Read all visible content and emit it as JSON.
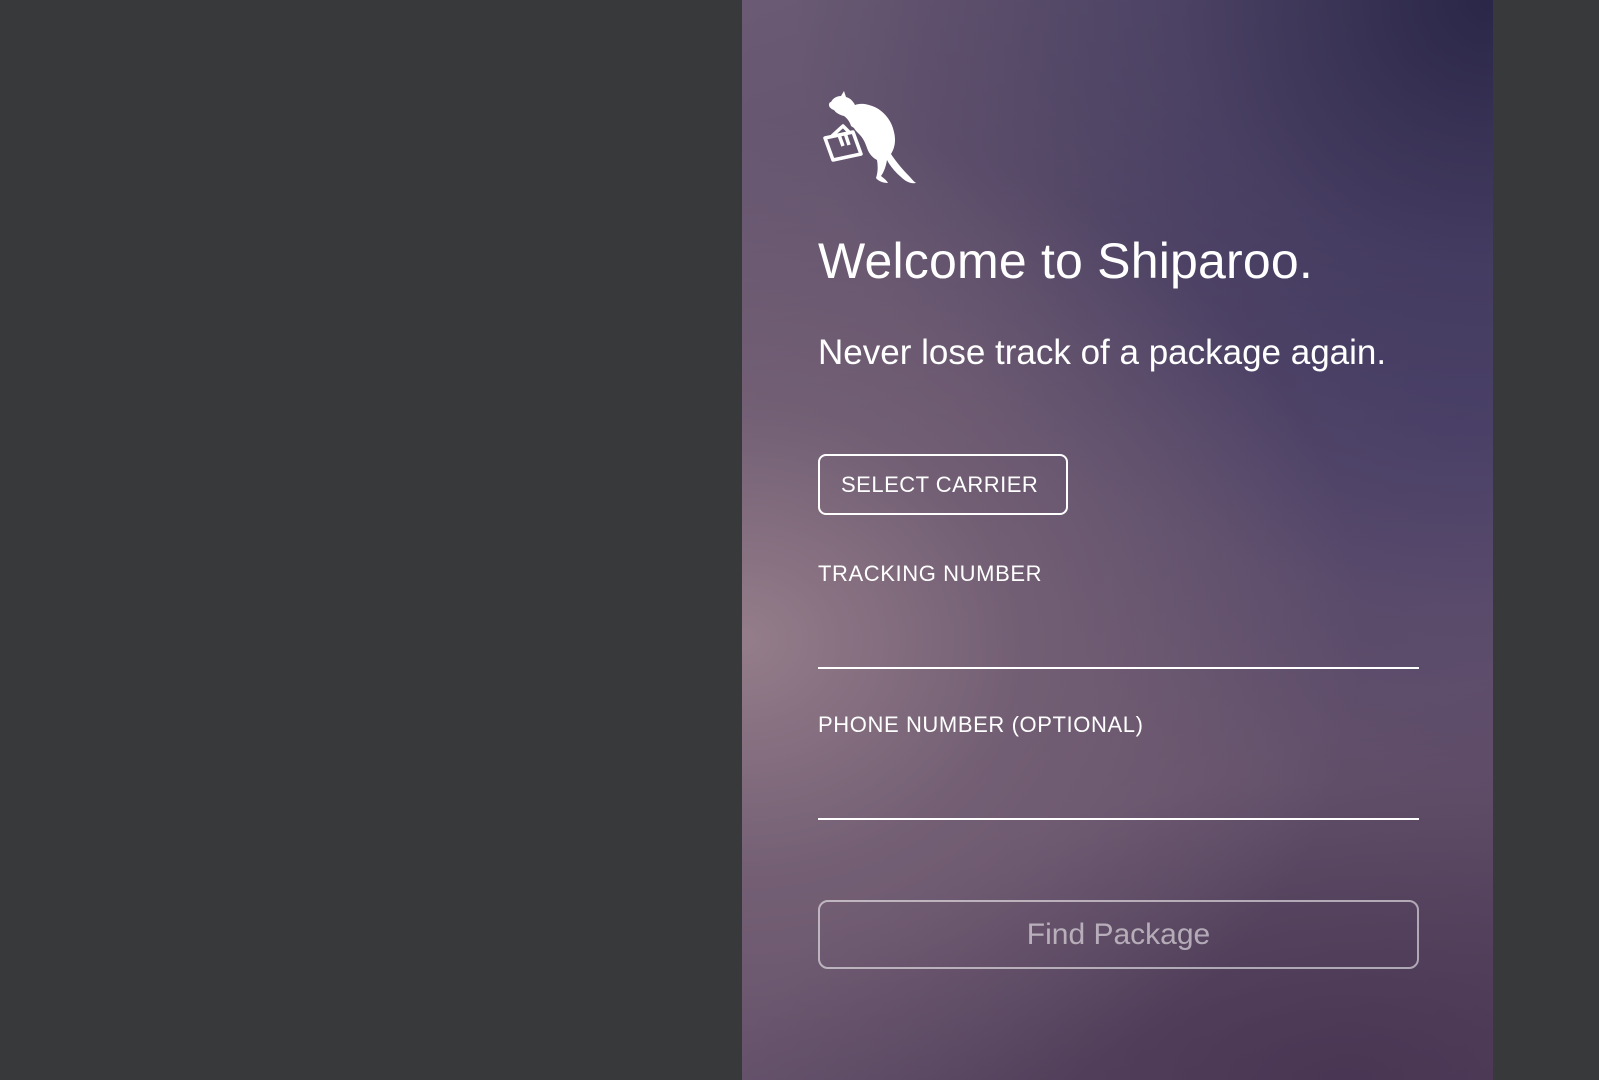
{
  "app": {
    "name": "Shiparoo",
    "logo_icon": "kangaroo-carrying-package-icon"
  },
  "hero": {
    "title": "Welcome to Shiparoo.",
    "subtitle": "Never lose track of a package again."
  },
  "form": {
    "carrier_button_label": "SELECT CARRIER",
    "tracking_label": "TRACKING NUMBER",
    "tracking_value": "",
    "phone_label": "PHONE NUMBER (OPTIONAL)",
    "phone_value": "",
    "submit_label": "Find Package"
  },
  "colors": {
    "page_background": "#38393b",
    "text": "#ffffff",
    "panel_gradient_top_right": "#262446",
    "panel_gradient_left": "#98808c"
  }
}
